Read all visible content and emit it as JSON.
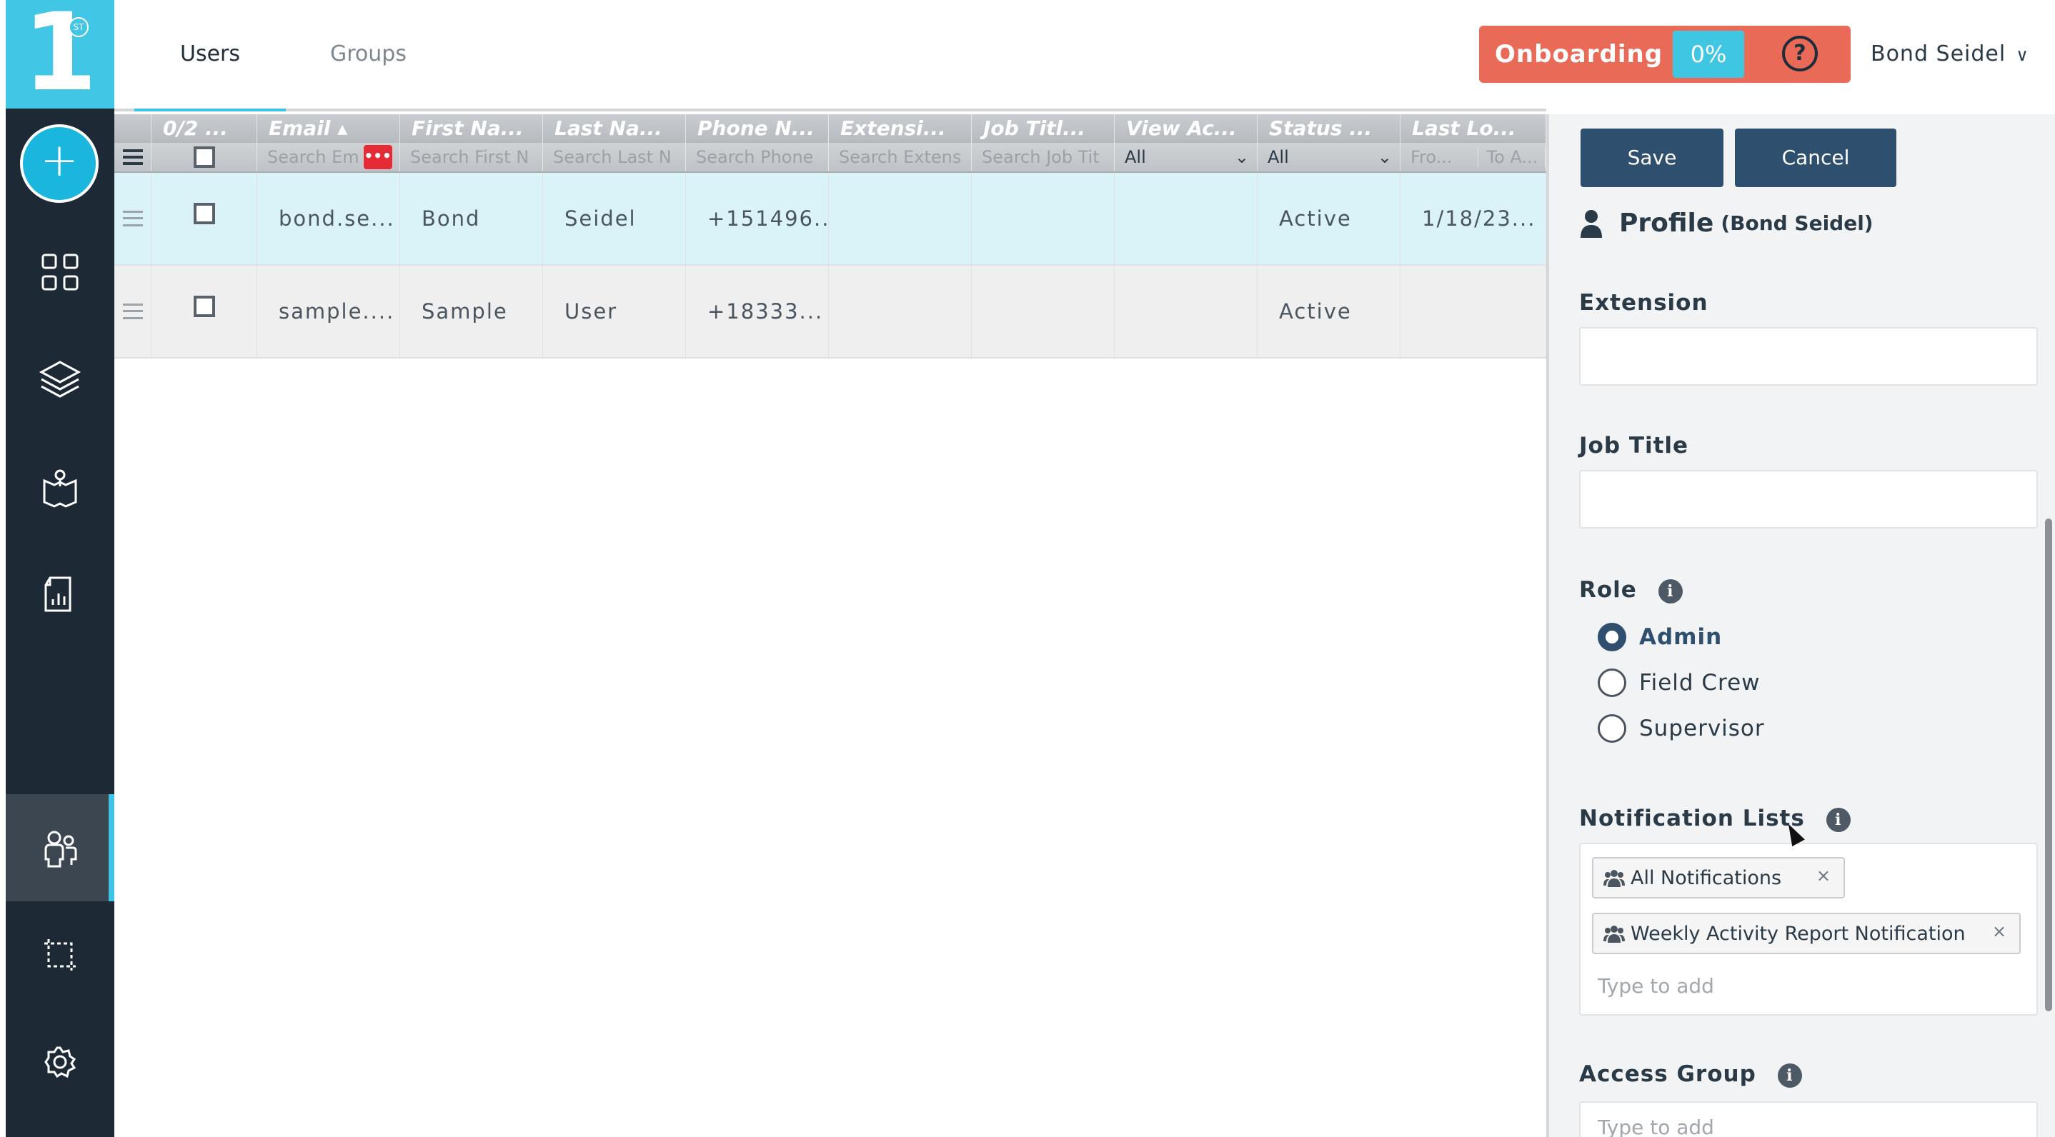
{
  "brand": {
    "logo_text": "1",
    "logo_badge": "ST",
    "accent_color": "#42c6e6",
    "sidebar_color": "#1d2a35"
  },
  "sidebar": {
    "add_icon": "plus-icon",
    "items": [
      {
        "icon": "dashboard-grid-icon",
        "active": false
      },
      {
        "icon": "layers-icon",
        "active": false
      },
      {
        "icon": "map-location-icon",
        "active": false
      },
      {
        "icon": "reports-icon",
        "active": false
      },
      {
        "icon": "users-icon",
        "active": true
      },
      {
        "icon": "crop-area-icon",
        "active": false
      },
      {
        "icon": "gear-icon",
        "active": false
      }
    ]
  },
  "header": {
    "tabs": [
      {
        "label": "Users",
        "active": true
      },
      {
        "label": "Groups",
        "active": false
      }
    ],
    "onboarding": {
      "label": "Onboarding",
      "percent": "0%",
      "color": "#ea6a58"
    },
    "help_icon": "question-circle-icon",
    "user_name": "Bond Seidel",
    "user_chevron": "∨"
  },
  "grid": {
    "columns": [
      "0/2 ...",
      "Email ▴",
      "First Na...",
      "Last Na...",
      "Phone N...",
      "Extensi...",
      "Job Titl...",
      "View Ac...",
      "Status ...",
      "Last Lo..."
    ],
    "filters": {
      "email": "Search Em",
      "first_name": "Search First N",
      "last_name": "Search Last N",
      "phone": "Search Phone",
      "extension": "Search Extens",
      "job_title": "Search Job Tit",
      "view_access": "All",
      "status": "All",
      "last_login_from": "Fro...",
      "last_login_to": "To A..."
    },
    "rows": [
      {
        "email": "bond.se...",
        "first_name": "Bond",
        "last_name": "Seidel",
        "phone": "+151496...",
        "extension": "",
        "job_title": "",
        "view_access": "",
        "status": "Active",
        "last_login": "1/18/23..."
      },
      {
        "email": "sample....",
        "first_name": "Sample",
        "last_name": "User",
        "phone": "+18333...",
        "extension": "",
        "job_title": "",
        "view_access": "",
        "status": "Active",
        "last_login": ""
      }
    ]
  },
  "panel": {
    "save_label": "Save",
    "cancel_label": "Cancel",
    "profile_title": "Profile",
    "profile_name": "(Bond Seidel)",
    "extension_label": "Extension",
    "extension_value": "",
    "job_title_label": "Job Title",
    "job_title_value": "",
    "role_label": "Role",
    "roles": [
      {
        "label": "Admin",
        "selected": true
      },
      {
        "label": "Field Crew",
        "selected": false
      },
      {
        "label": "Supervisor",
        "selected": false
      }
    ],
    "notification_label": "Notification Lists",
    "notification_tags": [
      "All Notifications",
      "Weekly Activity Report Notification"
    ],
    "notification_placeholder": "Type to add",
    "access_group_label": "Access Group",
    "access_group_placeholder": "Type to add",
    "button_color": "#2f4f6e"
  }
}
